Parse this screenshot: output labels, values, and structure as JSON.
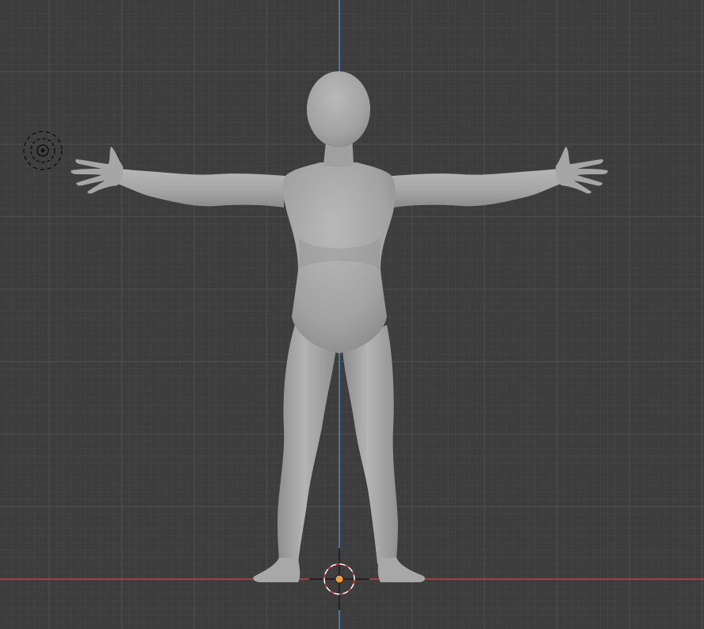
{
  "viewport": {
    "view": "front-orthographic",
    "background_color": "#3d3d3d",
    "grid_minor_color": "#434343",
    "grid_major_color": "#4a4a4a",
    "x_axis_color": "#c43c48",
    "z_axis_color": "#4e86c8",
    "origin_color": "#f0a030",
    "cursor_color": "#e83c3c"
  },
  "scene": {
    "object": "humanoid-base-mesh",
    "object_color": "#a7a7a7",
    "pose": "T-pose",
    "light_icon": "point-light-icon",
    "cursor_icon": "3d-cursor-icon",
    "origin_icon": "object-origin-icon"
  }
}
